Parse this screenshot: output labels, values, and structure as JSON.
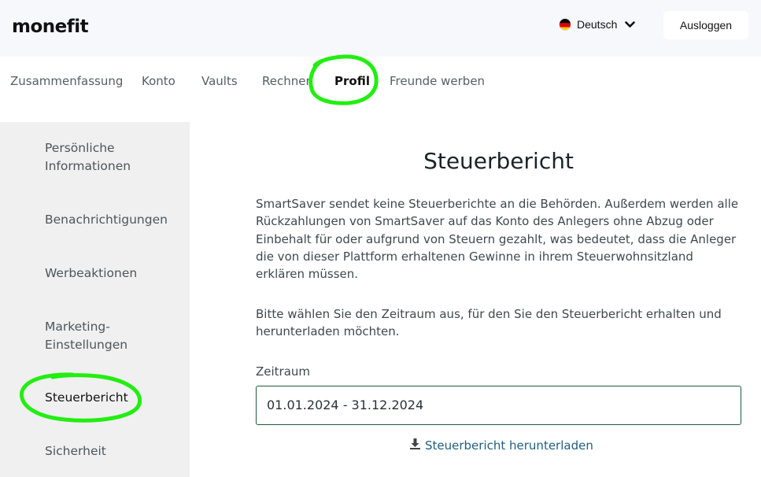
{
  "header": {
    "logo": "monefit",
    "language": "Deutsch",
    "logout_label": "Ausloggen"
  },
  "nav": {
    "items": [
      {
        "label": "Zusammenfassung"
      },
      {
        "label": "Konto"
      },
      {
        "label": "Vaults"
      },
      {
        "label": "Rechner"
      },
      {
        "label": "Profil",
        "active": true
      },
      {
        "label": "Freunde werben"
      }
    ]
  },
  "sidebar": {
    "items": [
      {
        "label": "Persönliche Informationen"
      },
      {
        "label": "Benachrichtigungen"
      },
      {
        "label": "Werbeaktionen"
      },
      {
        "label": "Marketing-Einstellungen"
      },
      {
        "label": "Steuerbericht",
        "active": true
      },
      {
        "label": "Sicherheit"
      }
    ]
  },
  "main": {
    "title": "Steuerbericht",
    "paragraph1": "SmartSaver sendet keine Steuerberichte an die Behörden. Außerdem werden alle Rückzahlungen von SmartSaver auf das Konto des Anlegers ohne Abzug oder Einbehalt für oder aufgrund von Steuern gezahlt, was bedeutet, dass die Anleger die von dieser Plattform erhaltenen Gewinne in ihrem Steuerwohnsitzland erklären müssen.",
    "paragraph2": "Bitte wählen Sie den Zeitraum aus, für den Sie den Steuerbericht erhalten und herunterladen möchten.",
    "period_label": "Zeitraum",
    "period_value": "01.01.2024 - 31.12.2024",
    "download_label": "Steuerbericht herunterladen"
  },
  "colors": {
    "highlight": "#22ee11",
    "link": "#1d5f7e",
    "field_border": "#1f5a3a"
  },
  "icons": {
    "language_flag": "germany-flag-icon",
    "language_dropdown": "chevron-down-icon",
    "download": "download-icon"
  }
}
